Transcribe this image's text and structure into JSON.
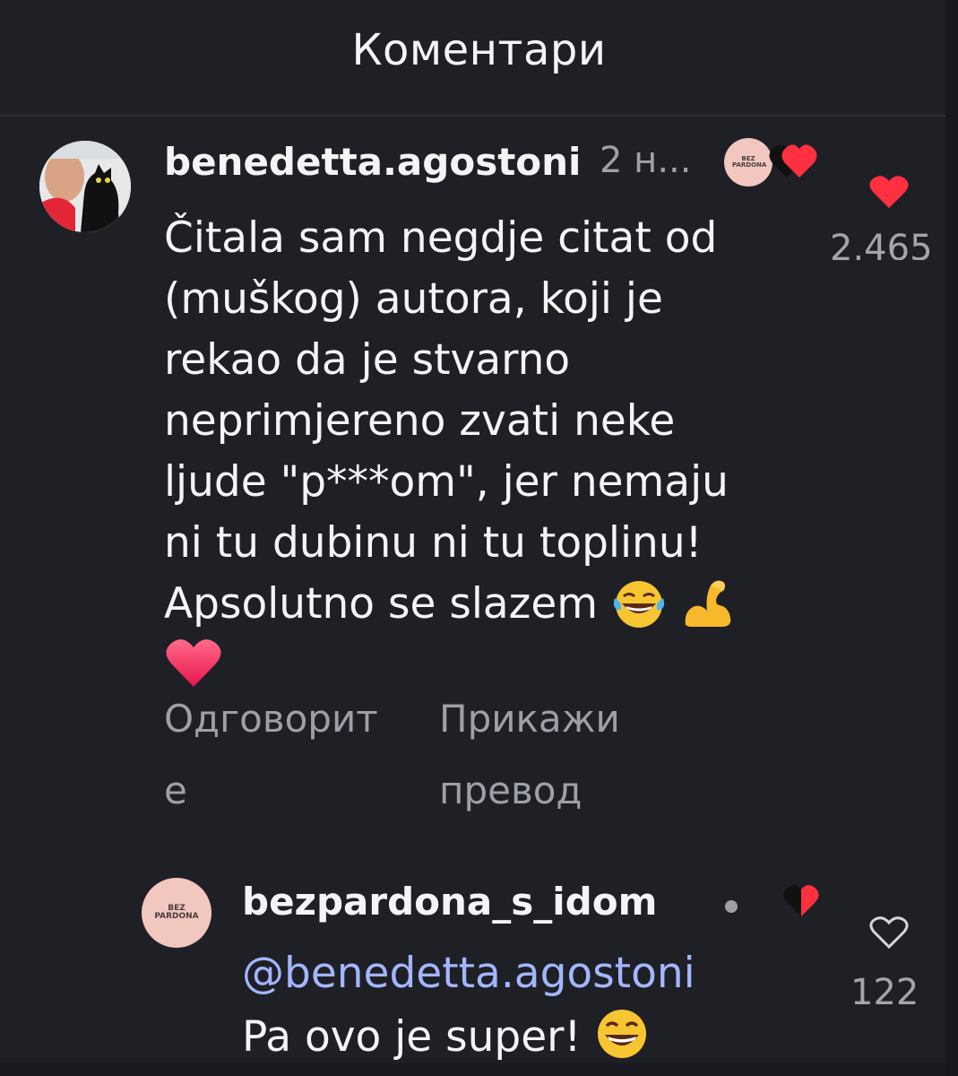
{
  "header": {
    "title": "Коментари"
  },
  "comment": {
    "username": "benedetta.agostoni",
    "time": "2 н...",
    "text_lines": [
      "Čitala sam negdje citat od",
      "(muškog) autora, koji je",
      "rekao da je stvarno",
      "neprimjereno zvati neke",
      "ljude \"p***om\", jer nemaju",
      "ni tu dubinu ni tu toplinu!",
      "Apsolutno se slazem"
    ],
    "emoji_inline": [
      "😂",
      "💪"
    ],
    "emoji_last": "❤️",
    "reply_label_part1": "Одговорит",
    "reply_label_part2": "е",
    "translate_label_part1": "Прикажи",
    "translate_label_part2": "превод",
    "likes": "2.465",
    "liked": true,
    "creator_badge_text": "BEZ PARDONA",
    "icons": {
      "avatar": "avatar-with-cat",
      "heart": "heart-filled-icon"
    },
    "colors": {
      "heart": "#ff3040",
      "muted": "#9ea0a8"
    }
  },
  "reply": {
    "username": "bezpardona_s_idom",
    "avatar_text": "BEZ PARDONA",
    "mention": "@benedetta.agostoni",
    "text": "Pa ovo je super!",
    "emoji": "😄",
    "likes": "122",
    "liked": false,
    "icons": {
      "heart": "heart-outline-icon"
    },
    "colors": {
      "mention": "#a4b6ff"
    }
  }
}
